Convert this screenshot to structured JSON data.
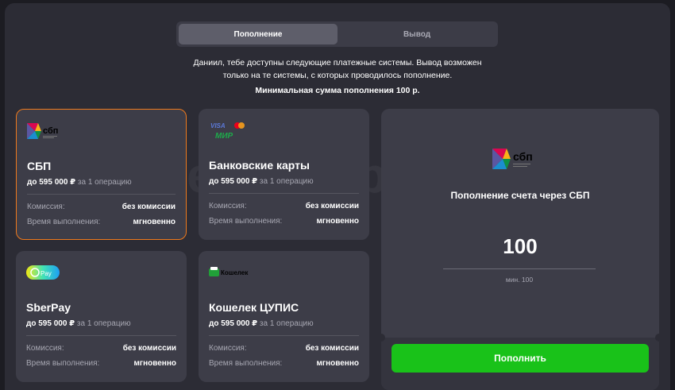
{
  "tabs": [
    {
      "label": "Пополнение",
      "active": true
    },
    {
      "label": "Вывод",
      "active": false
    }
  ],
  "info": {
    "line1": "Даниил, тебе доступны следующие платежные системы. Вывод возможен",
    "line2": "только на те системы, с которых проводилось пополнение.",
    "min_line": "Минимальная сумма пополнения 100 р."
  },
  "watermark": "Букмекеры.ру",
  "methods": [
    {
      "name": "СБП",
      "limit_amount": "до 595 000 ₽",
      "limit_suffix": "за 1 операцию",
      "commission_label": "Комиссия:",
      "commission": "без комиссии",
      "time_label": "Время выполнения:",
      "time": "мгновенно",
      "logo": "sbp-logo",
      "logo_text": "сбп",
      "selected": true
    },
    {
      "name": "Банковские карты",
      "limit_amount": "до 595 000 ₽",
      "limit_suffix": "за 1 операцию",
      "commission_label": "Комиссия:",
      "commission": "без комиссии",
      "time_label": "Время выполнения:",
      "time": "мгновенно",
      "logo": "visa-mastercard-mir-logo",
      "logo_text_visa": "VISA",
      "logo_text_mir": "МИР",
      "selected": false
    },
    {
      "name": "SberPay",
      "limit_amount": "до 595 000 ₽",
      "limit_suffix": "за 1 операцию",
      "commission_label": "Комиссия:",
      "commission": "без комиссии",
      "time_label": "Время выполнения:",
      "time": "мгновенно",
      "logo": "sberpay-logo",
      "logo_text": "Pay",
      "selected": false
    },
    {
      "name": "Кошелек ЦУПИС",
      "limit_amount": "до 595 000 ₽",
      "limit_suffix": "за 1 операцию",
      "commission_label": "Комиссия:",
      "commission": "без комиссии",
      "time_label": "Время выполнения:",
      "time": "мгновенно",
      "logo": "cupis-wallet-logo",
      "logo_text": "Кошелек",
      "selected": false
    }
  ],
  "deposit": {
    "logo_text": "сбп",
    "title": "Пополнение счета через СБП",
    "amount": "100",
    "min_label": "мин. 100",
    "submit_label": "Пополнить"
  },
  "colors": {
    "accent_selected": "#ef7a1c",
    "button_green": "#19c219",
    "card_bg": "#3d3d48",
    "panel_bg": "#2c2c35"
  }
}
